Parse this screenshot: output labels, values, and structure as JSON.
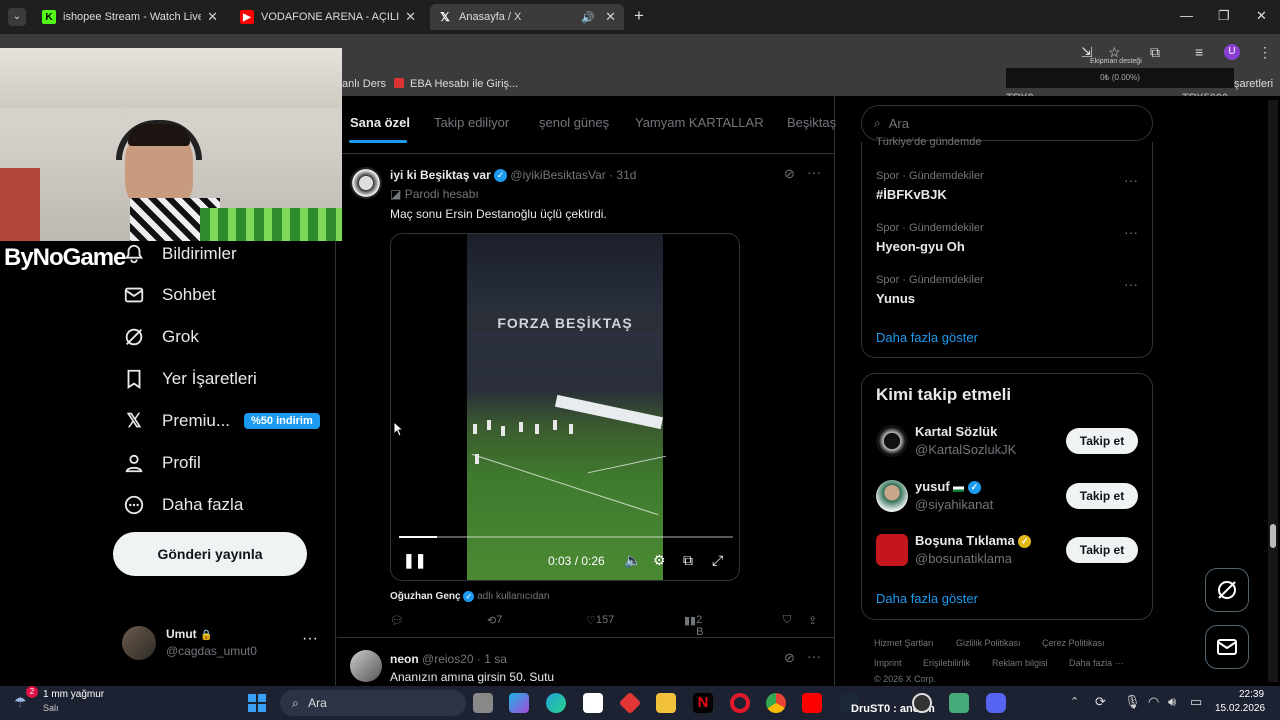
{
  "browser": {
    "tabs": [
      {
        "title": "ishopee Stream - Watch Live on",
        "close": "✕"
      },
      {
        "title": "VODAFONE ARENA - AÇILIŞ M",
        "close": "✕"
      },
      {
        "title": "Anasayfa / X",
        "close": "✕"
      }
    ],
    "new_tab": "+",
    "bookmarks": [
      "anlı Ders",
      "EBA Hesabı ile Giriş..."
    ],
    "bookmarks_right": "şaretleri",
    "donation": {
      "label": "Ekipman desteği",
      "progress": "0₺ (0.00%)",
      "progress_fraction": 0.0,
      "min": "TRY0",
      "max": "TRY5000"
    },
    "profile_initial": "U"
  },
  "nav": {
    "items": [
      {
        "label": "Bildirimler",
        "icon": "bell-icon"
      },
      {
        "label": "Sohbet",
        "icon": "mail-icon"
      },
      {
        "label": "Grok",
        "icon": "grok-icon"
      },
      {
        "label": "Yer İşaretleri",
        "icon": "bookmark-icon"
      },
      {
        "label": "Premiu...",
        "icon": "x-logo-icon"
      },
      {
        "label": "Profil",
        "icon": "person-icon"
      },
      {
        "label": "Daha fazla",
        "icon": "more-circle-icon"
      }
    ],
    "promo": "%50 indirim",
    "post_button": "Gönderi yayınla",
    "account": {
      "name": "Umut",
      "handle": "@cagdas_umut0",
      "lock": "🔒"
    }
  },
  "timeline": {
    "tabs": [
      "Sana özel",
      "Takip ediliyor",
      "şenol güneş",
      "Yamyam KARTALLAR",
      "Beşiktaş"
    ],
    "tweet1": {
      "name": "iyi ki Beşiktaş var",
      "handle": "@iyikiBesiktasVar",
      "time": "· 31d",
      "parody": "Parodi hesabı",
      "text": "Maç sonu Ersin Destanoğlu üçlü çektirdi.",
      "banner_text": "FORZA BEŞİKTAŞ",
      "video_time": "0:03 / 0:26",
      "video_progress": 0.115,
      "from_user": "Oğuzhan Genç",
      "from_suffix": "adlı kullanıcıdan",
      "replies": "",
      "reposts": "7",
      "likes": "157",
      "views": "2 B"
    },
    "tweet2": {
      "name": "neon",
      "handle": "@reios20",
      "time": "· 1 sa",
      "text": "Ananızın amına girsin 50. Sutu"
    }
  },
  "right": {
    "search_placeholder": "Ara",
    "top_cut": "Türkiye'de gündemde",
    "trends": [
      {
        "meta": "Spor · Gündemdekiler",
        "name": "#İBFKvBJK"
      },
      {
        "meta": "Spor · Gündemdekiler",
        "name": "Hyeon-gyu Oh"
      },
      {
        "meta": "Spor · Gündemdekiler",
        "name": "Yunus"
      }
    ],
    "show_more": "Daha fazla göster",
    "who_to_follow": {
      "title": "Kimi takip etmeli",
      "users": [
        {
          "name": "Kartal Sözlük",
          "handle": "@KartalSozlukJK",
          "verified": false
        },
        {
          "name": "yusuf",
          "handle": "@siyahikanat",
          "verified": true
        },
        {
          "name": "Boşuna Tıklama",
          "handle": "@bosunatiklama",
          "verified": true
        }
      ],
      "follow_label": "Takip et",
      "show_more": "Daha fazla göster"
    },
    "footer": [
      "Hizmet Şartları",
      "Gizlilik Politikası",
      "Çerez Politikası",
      "Imprint",
      "Erişilebilirlik",
      "Reklam bilgisi",
      "Daha fazla ···",
      "© 2026 X Corp."
    ]
  },
  "overlay": {
    "brand": "ByNoGame"
  },
  "taskbar": {
    "weather": "1 mm yağmur",
    "weather_sub": "Salı",
    "search": "Ara",
    "drust": "DruST0 : ancam",
    "time": "22:39",
    "date": "15.02.2026"
  }
}
